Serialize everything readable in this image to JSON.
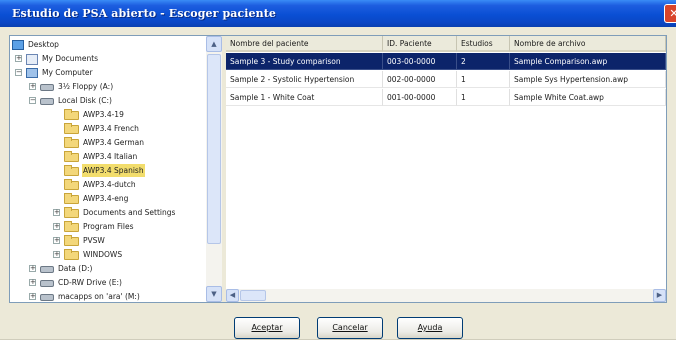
{
  "window": {
    "title": "Estudio de PSA abierto - Escoger paciente"
  },
  "tree": {
    "items": [
      {
        "label": "Desktop",
        "icon": "desktop-icon"
      },
      {
        "label": "My Documents",
        "icon": "my-documents-icon",
        "expander": "+"
      },
      {
        "label": "My Computer",
        "icon": "my-computer-icon",
        "expander": "−"
      },
      {
        "label": "3½ Floppy (A:)",
        "icon": "floppy-drive-icon",
        "expander": "+"
      },
      {
        "label": "Local Disk (C:)",
        "icon": "hard-drive-icon",
        "expander": "−"
      },
      {
        "label": "AWP3.4-19",
        "icon": "folder-icon"
      },
      {
        "label": "AWP3.4 French",
        "icon": "folder-icon"
      },
      {
        "label": "AWP3.4 German",
        "icon": "folder-icon"
      },
      {
        "label": "AWP3.4 Italian",
        "icon": "folder-icon"
      },
      {
        "label": "AWP3.4 Spanish",
        "icon": "folder-open-icon",
        "selected": true
      },
      {
        "label": "AWP3.4-dutch",
        "icon": "folder-icon"
      },
      {
        "label": "AWP3.4-eng",
        "icon": "folder-icon"
      },
      {
        "label": "Documents and Settings",
        "icon": "folder-icon",
        "expander": "+"
      },
      {
        "label": "Program Files",
        "icon": "folder-icon",
        "expander": "+"
      },
      {
        "label": "PVSW",
        "icon": "folder-icon",
        "expander": "+"
      },
      {
        "label": "WINDOWS",
        "icon": "folder-icon",
        "expander": "+"
      },
      {
        "label": "Data (D:)",
        "icon": "hard-drive-icon",
        "expander": "+"
      },
      {
        "label": "CD-RW Drive (E:)",
        "icon": "cd-drive-icon",
        "expander": "+"
      },
      {
        "label": "macapps on 'ara' (M:)",
        "icon": "network-drive-icon",
        "expander": "+"
      }
    ]
  },
  "table": {
    "columns": [
      "Nombre del paciente",
      "ID. Paciente",
      "Estudios",
      "Nombre de archivo"
    ],
    "rows": [
      {
        "cells": [
          "Sample 3 - Study comparison",
          "003-00-0000",
          "2",
          "Sample Comparison.awp"
        ],
        "selected": true
      },
      {
        "cells": [
          "Sample 2 - Systolic Hypertension",
          "002-00-0000",
          "1",
          "Sample Sys Hypertension.awp"
        ]
      },
      {
        "cells": [
          "Sample 1 - White Coat",
          "001-00-0000",
          "1",
          "Sample White Coat.awp"
        ]
      }
    ]
  },
  "buttons": {
    "accept": "Aceptar",
    "cancel": "Cancelar",
    "help": "Ayuda"
  },
  "colors": {
    "title_bar": "#0a4fd4",
    "selection": "#0c246a",
    "tree_selection": "#f2dd6c",
    "close": "#d9452b"
  }
}
